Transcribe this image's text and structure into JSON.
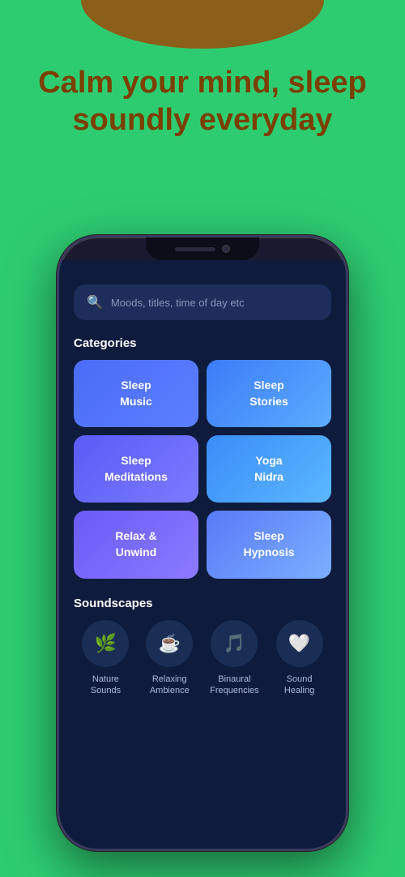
{
  "background_color": "#2ecc71",
  "hero": {
    "title": "Calm your mind, sleep soundly everyday"
  },
  "search": {
    "placeholder": "Moods, titles, time of day etc"
  },
  "categories_label": "Categories",
  "categories": [
    {
      "id": "sleep-music",
      "label": "Sleep\nMusic",
      "style": "card-sleep-music"
    },
    {
      "id": "sleep-stories",
      "label": "Sleep\nStories",
      "style": "card-sleep-stories"
    },
    {
      "id": "sleep-meditations",
      "label": "Sleep\nMeditations",
      "style": "card-sleep-meditations"
    },
    {
      "id": "yoga-nidra",
      "label": "Yoga\nNidra",
      "style": "card-yoga-nidra"
    },
    {
      "id": "relax-unwind",
      "label": "Relax &\nUnwind",
      "style": "card-relax-unwind"
    },
    {
      "id": "sleep-hypnosis",
      "label": "Sleep\nHypnosis",
      "style": "card-sleep-hypnosis"
    }
  ],
  "soundscapes_label": "Soundscapes",
  "soundscapes": [
    {
      "id": "nature-sounds",
      "icon": "🌿",
      "label": "Nature\nSounds"
    },
    {
      "id": "relaxing-ambience",
      "icon": "☕",
      "label": "Relaxing\nAmbience"
    },
    {
      "id": "binaural-frequencies",
      "icon": "🎵",
      "label": "Binaural\nFrequencies"
    },
    {
      "id": "sound-healing",
      "icon": "🤍",
      "label": "Sound\nHealing"
    }
  ]
}
